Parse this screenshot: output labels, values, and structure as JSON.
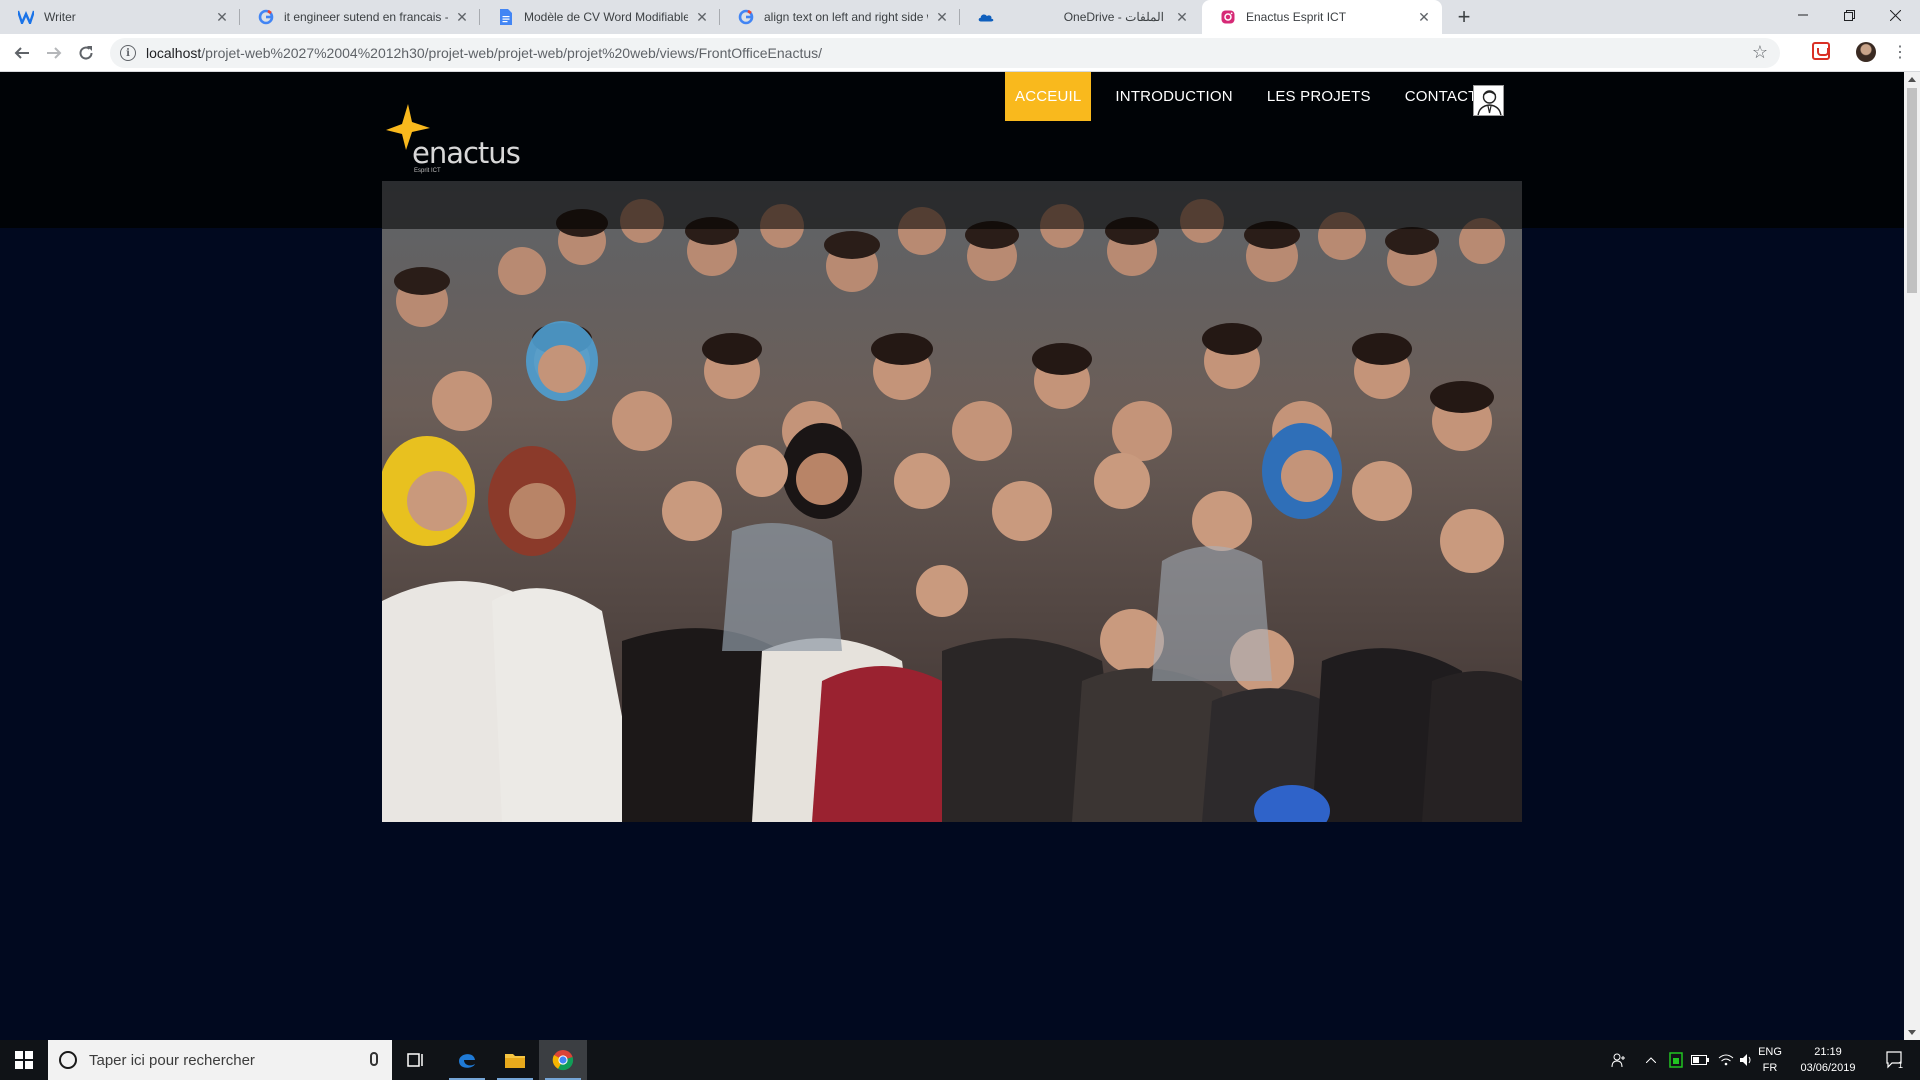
{
  "browser": {
    "tabs": [
      {
        "title": "Writer",
        "icon": "writer-w-icon",
        "active": false
      },
      {
        "title": "it engineer sutend en francais - R",
        "icon": "google-icon",
        "active": false
      },
      {
        "title": "Modèle de CV Word Modifiable (",
        "icon": "google-docs-icon",
        "active": false
      },
      {
        "title": "align text on left and right side w",
        "icon": "google-icon",
        "active": false
      },
      {
        "title": "OneDrive - الملفات",
        "icon": "onedrive-icon",
        "active": false
      },
      {
        "title": "Enactus Esprit ICT",
        "icon": "instagram-icon",
        "active": true
      }
    ],
    "url_host": "localhost",
    "url_path": "/projet-web%2027%2004%2012h30/projet-web/projet-web/projet%20web/views/FrontOfficeEnactus/"
  },
  "site": {
    "logo_text": "enactus",
    "logo_subtext": "Esprit ICT",
    "nav": [
      {
        "label": "ACCEUIL",
        "active": true
      },
      {
        "label": "INTRODUCTION",
        "active": false
      },
      {
        "label": "LES PROJETS",
        "active": false
      },
      {
        "label": "CONTACT",
        "active": false
      }
    ],
    "accent_color": "#f9b91d",
    "background_color": "#01091f"
  },
  "taskbar": {
    "search_placeholder": "Taper ici pour rechercher",
    "lang_primary": "ENG",
    "lang_secondary": "FR",
    "time": "21:19",
    "date": "03/06/2019",
    "notification_count": "1"
  }
}
